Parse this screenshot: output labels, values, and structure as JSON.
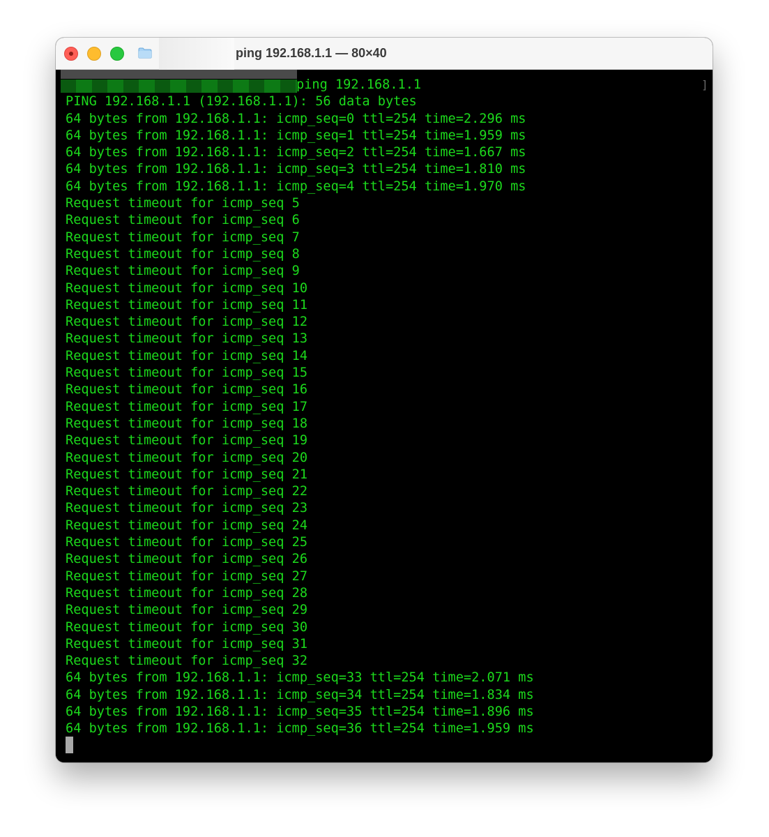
{
  "window": {
    "title": "ping 192.168.1.1 — 80×40"
  },
  "terminal": {
    "command": "ping 192.168.1.1",
    "lines": [
      "PING 192.168.1.1 (192.168.1.1): 56 data bytes",
      "64 bytes from 192.168.1.1: icmp_seq=0 ttl=254 time=2.296 ms",
      "64 bytes from 192.168.1.1: icmp_seq=1 ttl=254 time=1.959 ms",
      "64 bytes from 192.168.1.1: icmp_seq=2 ttl=254 time=1.667 ms",
      "64 bytes from 192.168.1.1: icmp_seq=3 ttl=254 time=1.810 ms",
      "64 bytes from 192.168.1.1: icmp_seq=4 ttl=254 time=1.970 ms",
      "Request timeout for icmp_seq 5",
      "Request timeout for icmp_seq 6",
      "Request timeout for icmp_seq 7",
      "Request timeout for icmp_seq 8",
      "Request timeout for icmp_seq 9",
      "Request timeout for icmp_seq 10",
      "Request timeout for icmp_seq 11",
      "Request timeout for icmp_seq 12",
      "Request timeout for icmp_seq 13",
      "Request timeout for icmp_seq 14",
      "Request timeout for icmp_seq 15",
      "Request timeout for icmp_seq 16",
      "Request timeout for icmp_seq 17",
      "Request timeout for icmp_seq 18",
      "Request timeout for icmp_seq 19",
      "Request timeout for icmp_seq 20",
      "Request timeout for icmp_seq 21",
      "Request timeout for icmp_seq 22",
      "Request timeout for icmp_seq 23",
      "Request timeout for icmp_seq 24",
      "Request timeout for icmp_seq 25",
      "Request timeout for icmp_seq 26",
      "Request timeout for icmp_seq 27",
      "Request timeout for icmp_seq 28",
      "Request timeout for icmp_seq 29",
      "Request timeout for icmp_seq 30",
      "Request timeout for icmp_seq 31",
      "Request timeout for icmp_seq 32",
      "64 bytes from 192.168.1.1: icmp_seq=33 ttl=254 time=2.071 ms",
      "64 bytes from 192.168.1.1: icmp_seq=34 ttl=254 time=1.834 ms",
      "64 bytes from 192.168.1.1: icmp_seq=35 ttl=254 time=1.896 ms",
      "64 bytes from 192.168.1.1: icmp_seq=36 ttl=254 time=1.959 ms"
    ],
    "scroll_marker": "]"
  },
  "icons": {
    "folder": "folder-icon",
    "cursor": "block-cursor"
  },
  "colors": {
    "text": "#1cd91c",
    "background": "#000000",
    "close": "#ff5f57",
    "minimize": "#febc2e",
    "maximize": "#28c840"
  }
}
